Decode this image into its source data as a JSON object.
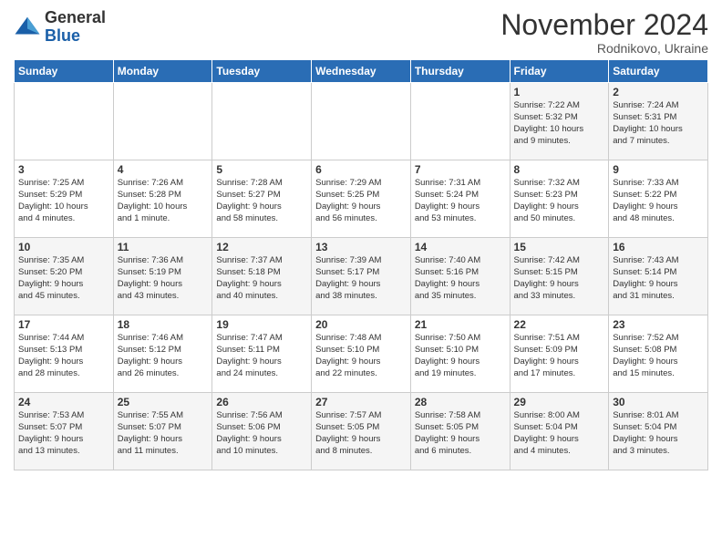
{
  "logo": {
    "general": "General",
    "blue": "Blue"
  },
  "title": "November 2024",
  "location": "Rodnikovo, Ukraine",
  "days_of_week": [
    "Sunday",
    "Monday",
    "Tuesday",
    "Wednesday",
    "Thursday",
    "Friday",
    "Saturday"
  ],
  "weeks": [
    [
      {
        "day": "",
        "info": ""
      },
      {
        "day": "",
        "info": ""
      },
      {
        "day": "",
        "info": ""
      },
      {
        "day": "",
        "info": ""
      },
      {
        "day": "",
        "info": ""
      },
      {
        "day": "1",
        "info": "Sunrise: 7:22 AM\nSunset: 5:32 PM\nDaylight: 10 hours\nand 9 minutes."
      },
      {
        "day": "2",
        "info": "Sunrise: 7:24 AM\nSunset: 5:31 PM\nDaylight: 10 hours\nand 7 minutes."
      }
    ],
    [
      {
        "day": "3",
        "info": "Sunrise: 7:25 AM\nSunset: 5:29 PM\nDaylight: 10 hours\nand 4 minutes."
      },
      {
        "day": "4",
        "info": "Sunrise: 7:26 AM\nSunset: 5:28 PM\nDaylight: 10 hours\nand 1 minute."
      },
      {
        "day": "5",
        "info": "Sunrise: 7:28 AM\nSunset: 5:27 PM\nDaylight: 9 hours\nand 58 minutes."
      },
      {
        "day": "6",
        "info": "Sunrise: 7:29 AM\nSunset: 5:25 PM\nDaylight: 9 hours\nand 56 minutes."
      },
      {
        "day": "7",
        "info": "Sunrise: 7:31 AM\nSunset: 5:24 PM\nDaylight: 9 hours\nand 53 minutes."
      },
      {
        "day": "8",
        "info": "Sunrise: 7:32 AM\nSunset: 5:23 PM\nDaylight: 9 hours\nand 50 minutes."
      },
      {
        "day": "9",
        "info": "Sunrise: 7:33 AM\nSunset: 5:22 PM\nDaylight: 9 hours\nand 48 minutes."
      }
    ],
    [
      {
        "day": "10",
        "info": "Sunrise: 7:35 AM\nSunset: 5:20 PM\nDaylight: 9 hours\nand 45 minutes."
      },
      {
        "day": "11",
        "info": "Sunrise: 7:36 AM\nSunset: 5:19 PM\nDaylight: 9 hours\nand 43 minutes."
      },
      {
        "day": "12",
        "info": "Sunrise: 7:37 AM\nSunset: 5:18 PM\nDaylight: 9 hours\nand 40 minutes."
      },
      {
        "day": "13",
        "info": "Sunrise: 7:39 AM\nSunset: 5:17 PM\nDaylight: 9 hours\nand 38 minutes."
      },
      {
        "day": "14",
        "info": "Sunrise: 7:40 AM\nSunset: 5:16 PM\nDaylight: 9 hours\nand 35 minutes."
      },
      {
        "day": "15",
        "info": "Sunrise: 7:42 AM\nSunset: 5:15 PM\nDaylight: 9 hours\nand 33 minutes."
      },
      {
        "day": "16",
        "info": "Sunrise: 7:43 AM\nSunset: 5:14 PM\nDaylight: 9 hours\nand 31 minutes."
      }
    ],
    [
      {
        "day": "17",
        "info": "Sunrise: 7:44 AM\nSunset: 5:13 PM\nDaylight: 9 hours\nand 28 minutes."
      },
      {
        "day": "18",
        "info": "Sunrise: 7:46 AM\nSunset: 5:12 PM\nDaylight: 9 hours\nand 26 minutes."
      },
      {
        "day": "19",
        "info": "Sunrise: 7:47 AM\nSunset: 5:11 PM\nDaylight: 9 hours\nand 24 minutes."
      },
      {
        "day": "20",
        "info": "Sunrise: 7:48 AM\nSunset: 5:10 PM\nDaylight: 9 hours\nand 22 minutes."
      },
      {
        "day": "21",
        "info": "Sunrise: 7:50 AM\nSunset: 5:10 PM\nDaylight: 9 hours\nand 19 minutes."
      },
      {
        "day": "22",
        "info": "Sunrise: 7:51 AM\nSunset: 5:09 PM\nDaylight: 9 hours\nand 17 minutes."
      },
      {
        "day": "23",
        "info": "Sunrise: 7:52 AM\nSunset: 5:08 PM\nDaylight: 9 hours\nand 15 minutes."
      }
    ],
    [
      {
        "day": "24",
        "info": "Sunrise: 7:53 AM\nSunset: 5:07 PM\nDaylight: 9 hours\nand 13 minutes."
      },
      {
        "day": "25",
        "info": "Sunrise: 7:55 AM\nSunset: 5:07 PM\nDaylight: 9 hours\nand 11 minutes."
      },
      {
        "day": "26",
        "info": "Sunrise: 7:56 AM\nSunset: 5:06 PM\nDaylight: 9 hours\nand 10 minutes."
      },
      {
        "day": "27",
        "info": "Sunrise: 7:57 AM\nSunset: 5:05 PM\nDaylight: 9 hours\nand 8 minutes."
      },
      {
        "day": "28",
        "info": "Sunrise: 7:58 AM\nSunset: 5:05 PM\nDaylight: 9 hours\nand 6 minutes."
      },
      {
        "day": "29",
        "info": "Sunrise: 8:00 AM\nSunset: 5:04 PM\nDaylight: 9 hours\nand 4 minutes."
      },
      {
        "day": "30",
        "info": "Sunrise: 8:01 AM\nSunset: 5:04 PM\nDaylight: 9 hours\nand 3 minutes."
      }
    ]
  ]
}
